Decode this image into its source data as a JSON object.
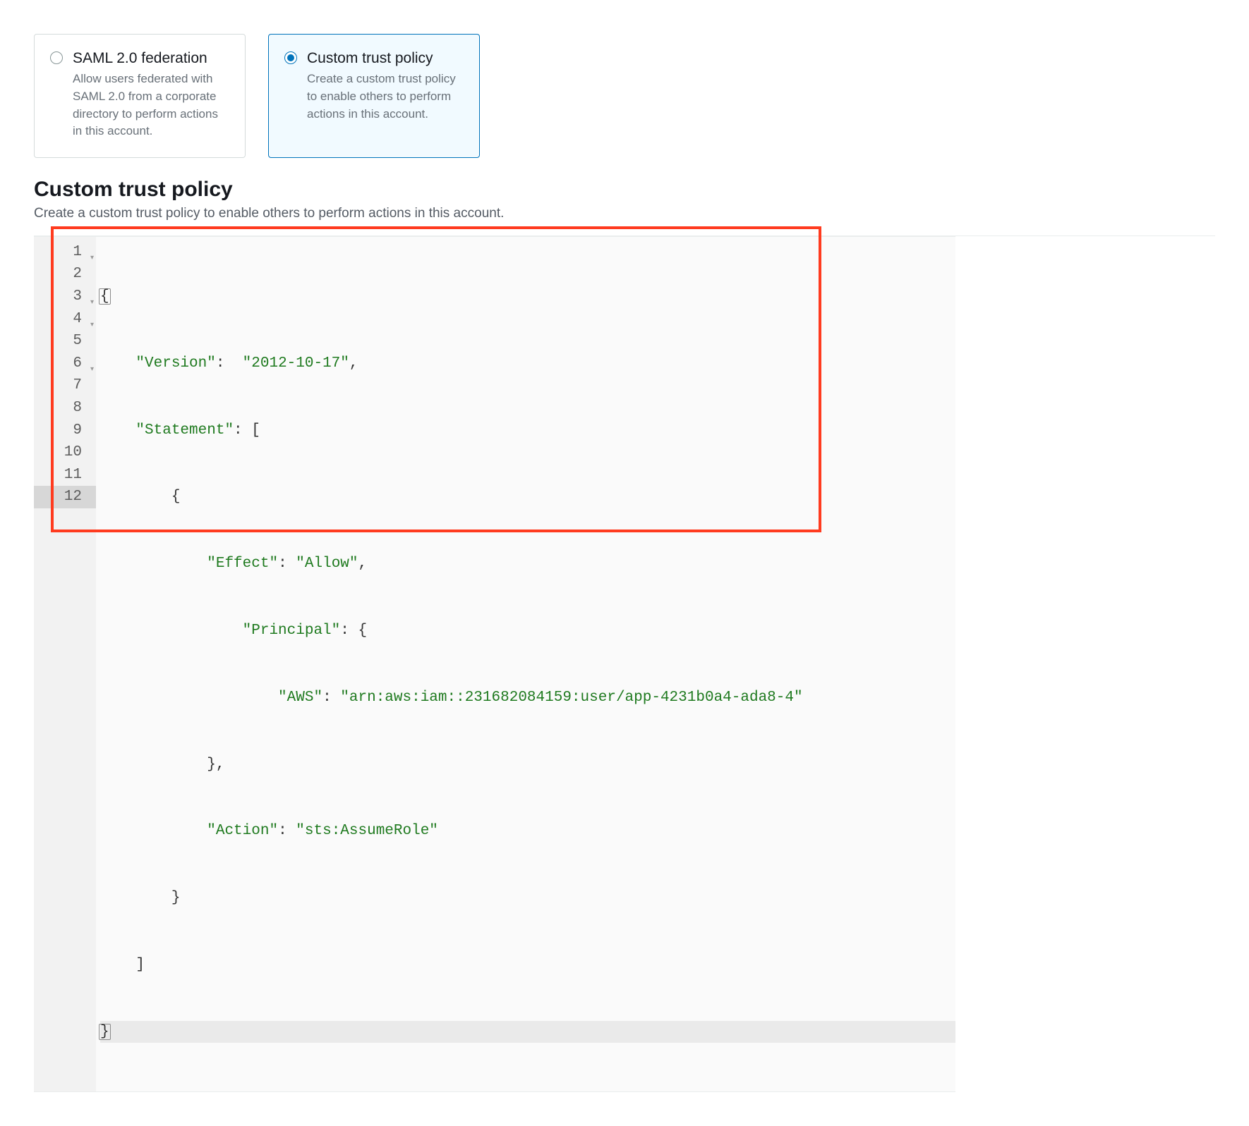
{
  "options": {
    "saml": {
      "title": "SAML 2.0 federation",
      "desc": "Allow users federated with SAML 2.0 from a corporate directory to perform actions in this account."
    },
    "custom": {
      "title": "Custom trust policy",
      "desc": "Create a custom trust policy to enable others to perform actions in this account."
    }
  },
  "section": {
    "title": "Custom trust policy",
    "desc": "Create a custom trust policy to enable others to perform actions in this account."
  },
  "editor": {
    "line_numbers": [
      "1",
      "2",
      "3",
      "4",
      "5",
      "6",
      "7",
      "8",
      "9",
      "10",
      "11",
      "12"
    ],
    "fold_lines": [
      1,
      3,
      4,
      6
    ],
    "active_line": 12,
    "l1": "{",
    "l2_k": "\"Version\"",
    "l2_c": ":  ",
    "l2_v": "\"2012-10-17\"",
    "l2_t": ",",
    "l3_k": "\"Statement\"",
    "l3_c": ": ",
    "l3_b": "[",
    "l4": "{",
    "l5_k": "\"Effect\"",
    "l5_c": ": ",
    "l5_v": "\"Allow\"",
    "l5_t": ",",
    "l6_k": "\"Principal\"",
    "l6_c": ": ",
    "l6_b": "{",
    "l7_k": "\"AWS\"",
    "l7_c": ": ",
    "l7_v": "\"arn:aws:iam::231682084159:user/app-4231b0a4-ada8-4\"",
    "l8": "},",
    "l9_k": "\"Action\"",
    "l9_c": ": ",
    "l9_v": "\"sts:AssumeRole\"",
    "l10": "}",
    "l11": "]",
    "l12": "}"
  },
  "policy_json": {
    "Version": "2012-10-17",
    "Statement": [
      {
        "Effect": "Allow",
        "Principal": {
          "AWS": "arn:aws:iam::231682084159:user/app-4231b0a4-ada8-4"
        },
        "Action": "sts:AssumeRole"
      }
    ]
  }
}
